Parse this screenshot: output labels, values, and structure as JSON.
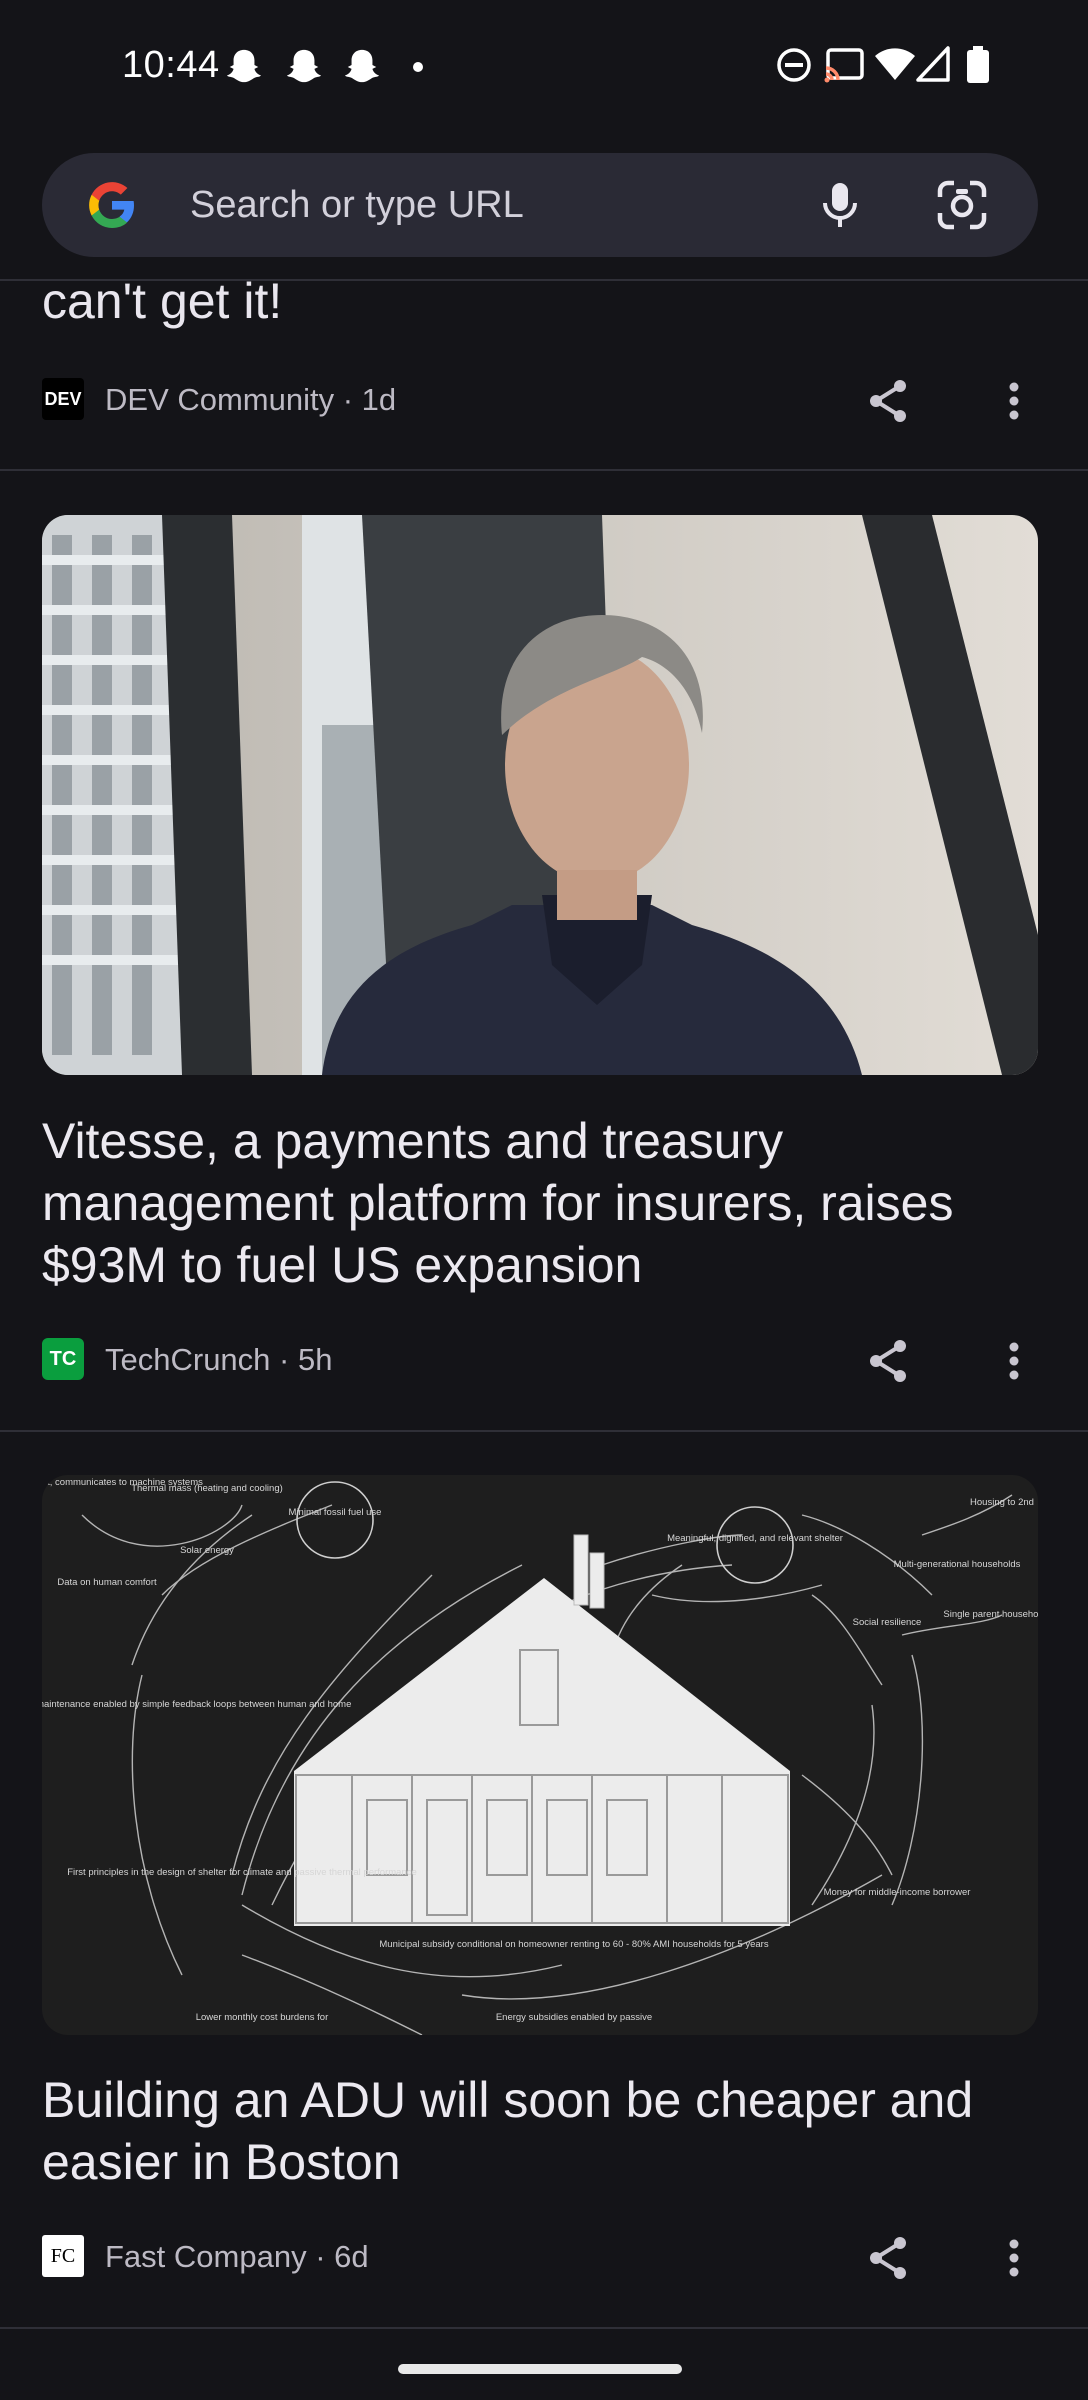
{
  "status_bar": {
    "time": "10:44",
    "notification_icons": [
      "snapchat-ghost-icon",
      "snapchat-ghost-icon",
      "snapchat-ghost-icon",
      "dot-icon"
    ],
    "system_icons": [
      "do-not-disturb-icon",
      "cast-icon",
      "wifi-icon",
      "signal-icon",
      "battery-icon"
    ]
  },
  "search": {
    "placeholder": "Search or type URL"
  },
  "feed": {
    "partial_card": {
      "title": "can't get it!",
      "source": "DEV Community · 1d",
      "source_icon_text": "DEV"
    },
    "cards": [
      {
        "title": "Vitesse, a payments and treasury management platform for insurers, raises $93M to fuel US expansion",
        "source": "TechCrunch · 5h",
        "source_icon_text": "TC",
        "image": "portrait-photo"
      },
      {
        "title": "Building an ADU will soon be cheaper and easier in Boston",
        "source": "Fast Company · 6d",
        "source_icon_text": "FC",
        "image": "adu-diagram",
        "diagram_labels": {
          "l1": "analyzes data, communicates to machine systems",
          "l2": "Thermal mass (heating and cooling)",
          "l3": "Minimal fossil fuel use",
          "l4": "Solar energy",
          "l5": "Data on human comfort",
          "l6": "Meaningful, dignified, and relevant shelter",
          "l7": "Housing to 2nd",
          "l8": "Multi-generational households",
          "l9": "Single parent households",
          "l10": "Social resilience",
          "l11": "Stewardship and maintenance enabled by simple feedback loops between human and home",
          "l12": "First principles in the design of shelter for climate and passive thermal performance",
          "l13": "Money for middle-income borrower",
          "l14": "Municipal subsidy conditional on homeowner renting to 60 - 80% AMI households for 5 years",
          "l15": "Lower monthly cost burdens for",
          "l16": "Energy subsidies enabled by passive"
        }
      }
    ]
  },
  "colors": {
    "background": "#141418",
    "search_bg": "#2a2a35",
    "techcrunch_green": "#0a9e3e"
  }
}
